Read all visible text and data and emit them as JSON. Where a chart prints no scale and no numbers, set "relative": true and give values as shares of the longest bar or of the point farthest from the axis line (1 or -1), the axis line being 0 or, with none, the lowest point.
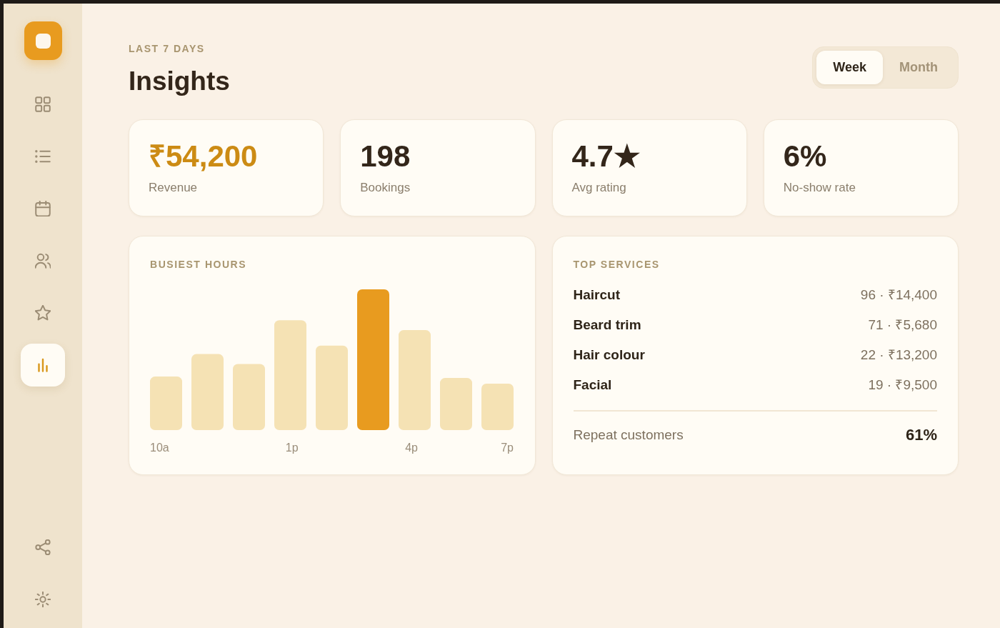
{
  "sidebar": {
    "nav_items": [
      {
        "selected": false
      },
      {
        "selected": false
      },
      {
        "selected": false
      },
      {
        "selected": false
      },
      {
        "selected": false
      },
      {
        "selected": true
      }
    ]
  },
  "header": {
    "eyebrow": "LAST 7 DAYS",
    "title": "Insights"
  },
  "period_toggle": [
    {
      "label": "Week",
      "selected": true
    },
    {
      "label": "Month",
      "selected": false
    }
  ],
  "stats": [
    {
      "value": "₹54,200",
      "label": "Revenue",
      "accent": true
    },
    {
      "value": "198",
      "label": "Bookings",
      "accent": false
    },
    {
      "value": "4.7★",
      "label": "Avg rating",
      "accent": false
    },
    {
      "value": "6%",
      "label": "No-show rate",
      "accent": false
    }
  ],
  "busiest_hours": {
    "chart_data": {
      "type": "bar",
      "title": "BUSIEST HOURS",
      "relative": true,
      "stacked": true,
      "categories": [
        "10a",
        null,
        null,
        "1p",
        null,
        null,
        "4p",
        null,
        "7p"
      ],
      "series": [
        {
          "color": "#f5e2b4",
          "values": [
            0.38,
            0.54,
            0.47,
            0.78,
            0.6,
            0,
            0.71,
            0.37,
            0.33
          ]
        },
        {
          "color": "#e89b1f",
          "values": [
            0,
            0,
            0,
            0,
            0,
            1.0,
            0,
            0,
            0
          ]
        }
      ]
    }
  },
  "top_services": {
    "title": "TOP SERVICES",
    "rows": [
      {
        "name": "Haircut",
        "stats": "96 · ₹14,400"
      },
      {
        "name": "Beard trim",
        "stats": "71 · ₹5,680"
      },
      {
        "name": "Hair colour",
        "stats": "22 · ₹13,200"
      },
      {
        "name": "Facial",
        "stats": "19 · ₹9,500"
      }
    ],
    "summary": {
      "label": "Repeat customers",
      "value": "61%"
    }
  }
}
